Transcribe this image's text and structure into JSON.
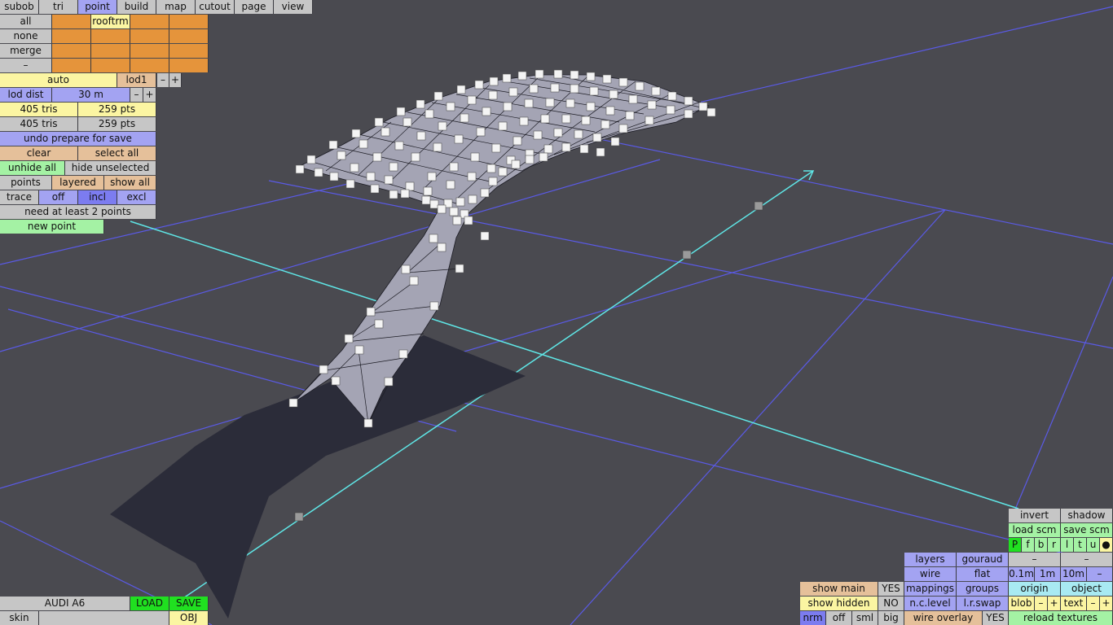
{
  "menu": {
    "tabs": [
      "subob",
      "tri",
      "point",
      "build",
      "map",
      "cutout",
      "page",
      "view"
    ],
    "active": "point"
  },
  "selection": {
    "all": "all",
    "none": "none",
    "merge": "merge",
    "dash": "–",
    "layer_label": "rooftrm"
  },
  "lod": {
    "auto": "auto",
    "lod": "lod1",
    "minus": "–",
    "plus": "+",
    "dist_label": "lod dist",
    "dist_value": "30 m"
  },
  "stats": {
    "row1_tris": "405 tris",
    "row1_pts": "259 pts",
    "row2_tris": "405 tris",
    "row2_pts": "259 pts"
  },
  "actions": {
    "undo": "undo prepare for save",
    "clear": "clear",
    "select_all": "select all",
    "unhide_all": "unhide all",
    "hide_unselected": "hide unselected",
    "points": "points",
    "layered": "layered",
    "show_all": "show all",
    "trace": "trace",
    "off": "off",
    "incl": "incl",
    "excl": "excl",
    "status": "need at least 2 points",
    "new_point": "new point"
  },
  "file": {
    "car_name": "AUDI A6",
    "load": "LOAD",
    "save": "SAVE",
    "skin": "skin",
    "obj": "OBJ"
  },
  "view_panel": {
    "invert": "invert",
    "shadow": "shadow",
    "load_scm": "load scm",
    "save_scm": "save scm",
    "views": [
      "P",
      "f",
      "b",
      "r",
      "l",
      "t",
      "u",
      "●"
    ],
    "layers": "layers",
    "gouraud": "gouraud",
    "dash1": "–",
    "dash2": "–",
    "wire": "wire",
    "flat": "flat",
    "g01": "0.1m",
    "g1": "1m",
    "g10": "10m",
    "gdash": "–",
    "show_main": "show main",
    "show_main_val": "YES",
    "mappings": "mappings",
    "groups": "groups",
    "origin": "origin",
    "object": "object",
    "show_hidden": "show hidden",
    "show_hidden_val": "NO",
    "nclevel": "n.c.level",
    "lrswap": "l.r.swap",
    "blob": "blob",
    "blob_minus": "–",
    "blob_plus": "+",
    "text": "text",
    "text_minus": "–",
    "text_plus": "+",
    "nrm": "nrm",
    "off": "off",
    "sml": "sml",
    "big": "big",
    "wire_overlay": "wire overlay",
    "wire_overlay_val": "YES",
    "reload_textures": "reload textures"
  }
}
